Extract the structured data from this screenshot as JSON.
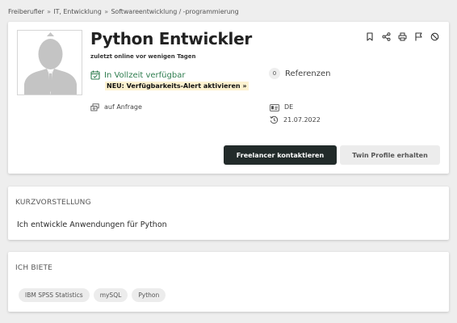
{
  "breadcrumb": {
    "items": [
      "Freiberufler",
      "IT, Entwicklung",
      "Softwareentwicklung / -programmierung"
    ],
    "separator": "»"
  },
  "profile": {
    "title": "Python Entwickler",
    "last_online": "zuletzt online vor wenigen Tagen",
    "availability": "In Vollzeit verfügbar",
    "alert_link": "NEU: Verfügbarkeits-Alert aktivieren »",
    "rate": "auf Anfrage",
    "references_count": "0",
    "references_label": "Referenzen",
    "country": "DE",
    "date": "21.07.2022",
    "icons": [
      "bookmark-icon",
      "share-icon",
      "print-icon",
      "flag-icon",
      "block-icon"
    ],
    "primary_button": "Freelancer kontaktieren",
    "secondary_button": "Twin Profile erhalten"
  },
  "intro": {
    "heading": "KURZVORSTELLUNG",
    "text": "Ich entwickle Anwendungen für Python"
  },
  "offer": {
    "heading": "ICH BIETE",
    "tags": [
      "IBM SPSS Statistics",
      "mySQL",
      "Python"
    ]
  },
  "colors": {
    "accent_green": "#2f7d4f",
    "primary_button": "#222b2a",
    "alert_highlight": "#fdf2d0",
    "page_background": "#eeeeee"
  }
}
